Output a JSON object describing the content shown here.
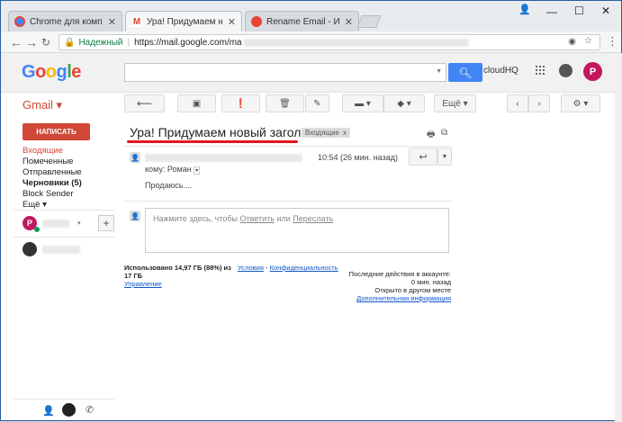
{
  "browser": {
    "tabs": [
      {
        "title": "Chrome для компьютер",
        "favicon_color": "#4285f4",
        "active": false
      },
      {
        "title": "Ура! Придумаем новый",
        "favicon_color": "#d14836",
        "active": true
      },
      {
        "title": "Rename Email - Интерне",
        "favicon_color": "#ea4335",
        "active": false
      }
    ],
    "security_label": "Надежный",
    "url": "https://mail.google.com/ma"
  },
  "header": {
    "logo": "Google",
    "cloudhq": "cloudHQ",
    "avatar_letter": "P"
  },
  "toolbar": {
    "app_label": "Gmail ▾",
    "more_label": "Ещё ▾"
  },
  "sidebar": {
    "compose_label": "НАПИСАТЬ",
    "folders": [
      {
        "label": "Входящие",
        "style": "inbox"
      },
      {
        "label": "Помеченные",
        "style": ""
      },
      {
        "label": "Отправленные",
        "style": ""
      },
      {
        "label": "Черновики (5)",
        "style": "bold"
      },
      {
        "label": "Block Sender",
        "style": ""
      },
      {
        "label": "Ещё ▾",
        "style": ""
      }
    ],
    "account_letter": "P",
    "add_label": "+"
  },
  "message": {
    "subject": "Ура! Придумаем новый заголовок!",
    "label": "Входящие",
    "label_close": "x",
    "time": "10:54 (26 мин. назад)",
    "to": "кому: Роман",
    "body": "Продаюсь....",
    "reply_prompt_prefix": "Нажмите здесь, чтобы ",
    "reply_link": "Ответить",
    "reply_mid": " или ",
    "forward_link": "Переслать"
  },
  "footer": {
    "storage_used": "Использовано 14,97 ГБ (88%) из",
    "storage_total": "17 ГБ",
    "manage": "Управление",
    "terms": "Условия",
    "dash": " - ",
    "privacy": "Конфиденциальность",
    "activity_1": "Последние действия в аккаунте:",
    "activity_2": "0 мин. назад",
    "activity_3": "Открыто в другом месте",
    "activity_details": "Дополнительная информация"
  },
  "colors": {
    "accent_red": "#d14836",
    "search_blue": "#4285f4",
    "avatar_pink": "#c2185b"
  }
}
